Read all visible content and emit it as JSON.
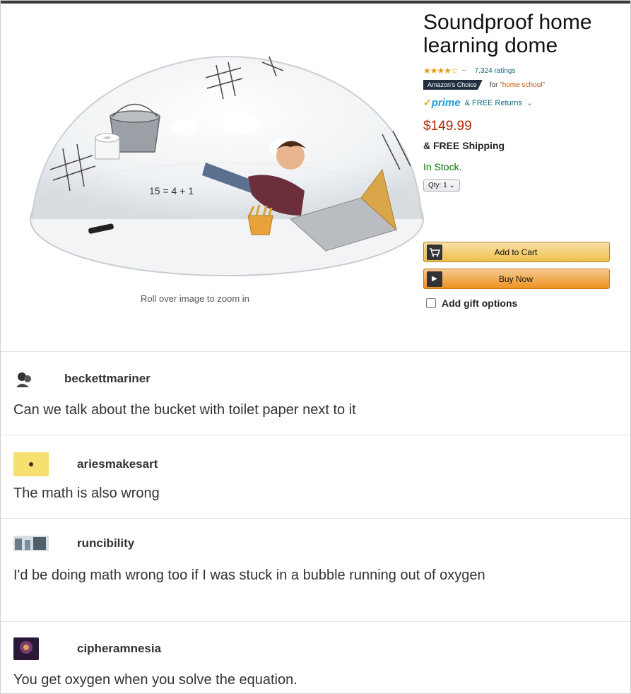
{
  "product": {
    "title": "Soundproof home learning dome",
    "stars": "★★★★☆",
    "ratings_count": "7,324 ratings",
    "rating_separator": "~",
    "choice_badge": "Amazon's Choice",
    "choice_prefix": "for ",
    "choice_term": "\"home school\"",
    "prime": "prime",
    "returns": "& FREE Returns",
    "returns_chevron": "⌄",
    "price": "$149.99",
    "shipping": "& FREE Shipping",
    "stock": "In Stock.",
    "qty": "Qty: 1",
    "qty_chevron": "⌄",
    "add_to_cart": "Add to Cart",
    "buy_now": "Buy Now",
    "gift_options": "Add gift options",
    "zoom_caption": "Roll over image to zoom in",
    "equation_text": "15 = 4 + 1"
  },
  "comments": [
    {
      "username": "beckettmariner",
      "text": "Can we talk about the bucket with toilet paper next to it"
    },
    {
      "username": "ariesmakesart",
      "text": "The math is also wrong"
    },
    {
      "username": "runcibility",
      "text": "I'd be doing math wrong too if I was stuck in a bubble running out of oxygen"
    },
    {
      "username": "cipheramnesia",
      "text": "You get oxygen when you solve the equation."
    }
  ],
  "colors": {
    "price": "#b12704",
    "stock": "#007600",
    "prime": "#1f9ed8",
    "cart_button": "#f0c14b",
    "buy_button": "#ed9220"
  },
  "icons": [
    "cart-icon",
    "play-icon",
    "checkbox-icon",
    "star-icon"
  ]
}
